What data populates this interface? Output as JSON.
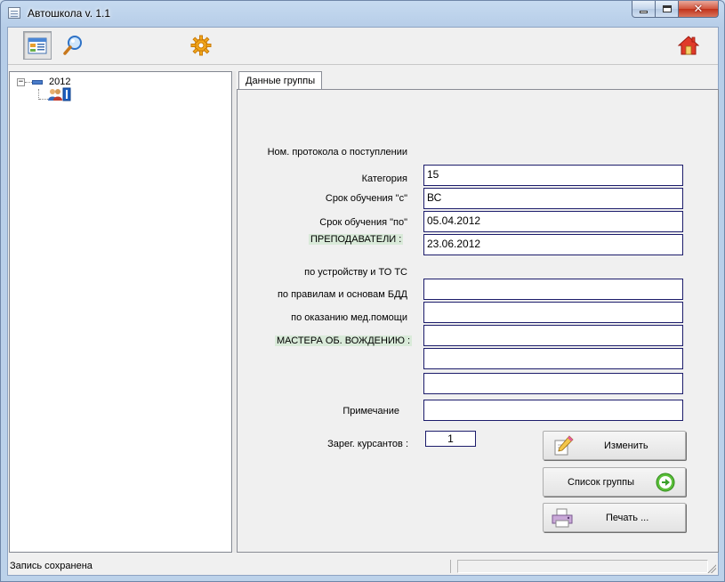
{
  "window": {
    "title": "Автошкола v. 1.1",
    "controls": [
      "minimize-icon",
      "maximize-icon",
      "close-icon"
    ]
  },
  "toolbar": {
    "buttons": [
      "group-list-icon",
      "search-icon",
      "settings-gear-icon",
      "home-icon"
    ]
  },
  "tree": {
    "root_label": "2012",
    "child_icon": "students-group-icon"
  },
  "tab": {
    "label": "Данные группы"
  },
  "form": {
    "protocol_label": "Ном. протокола о поступлении",
    "protocol_value": "15",
    "category_label": "Категория",
    "category_value": "ВС",
    "from_label": "Срок обучения \"с\"",
    "from_value": "05.04.2012",
    "to_label": "Срок обучения \"по\"",
    "to_value": "23.06.2012",
    "teachers_header": "ПРЕПОДАВАТЕЛИ :",
    "device_label": "по устройству и ТО ТС",
    "device_value": "",
    "rules_label": "по правилам и основам БДД",
    "rules_value": "",
    "medical_label": "по оказанию мед.помощи",
    "medical_value": "",
    "masters_header": "МАСТЕРА ОБ. ВОЖДЕНИЮ :",
    "master1_value": "",
    "master2_value": "",
    "note_label": "Примечание",
    "note_value": "",
    "registered_label": "Зарег. курсантов :",
    "registered_value": "1"
  },
  "buttons": {
    "edit_label": "Изменить",
    "list_label": "Список группы",
    "print_label": "Печать ..."
  },
  "status": {
    "text": "Запись сохранена"
  },
  "colors": {
    "header_highlight": "#d9ead9",
    "field_border": "#1c1c6b",
    "go_arrow_green": "#5bbf3a"
  }
}
